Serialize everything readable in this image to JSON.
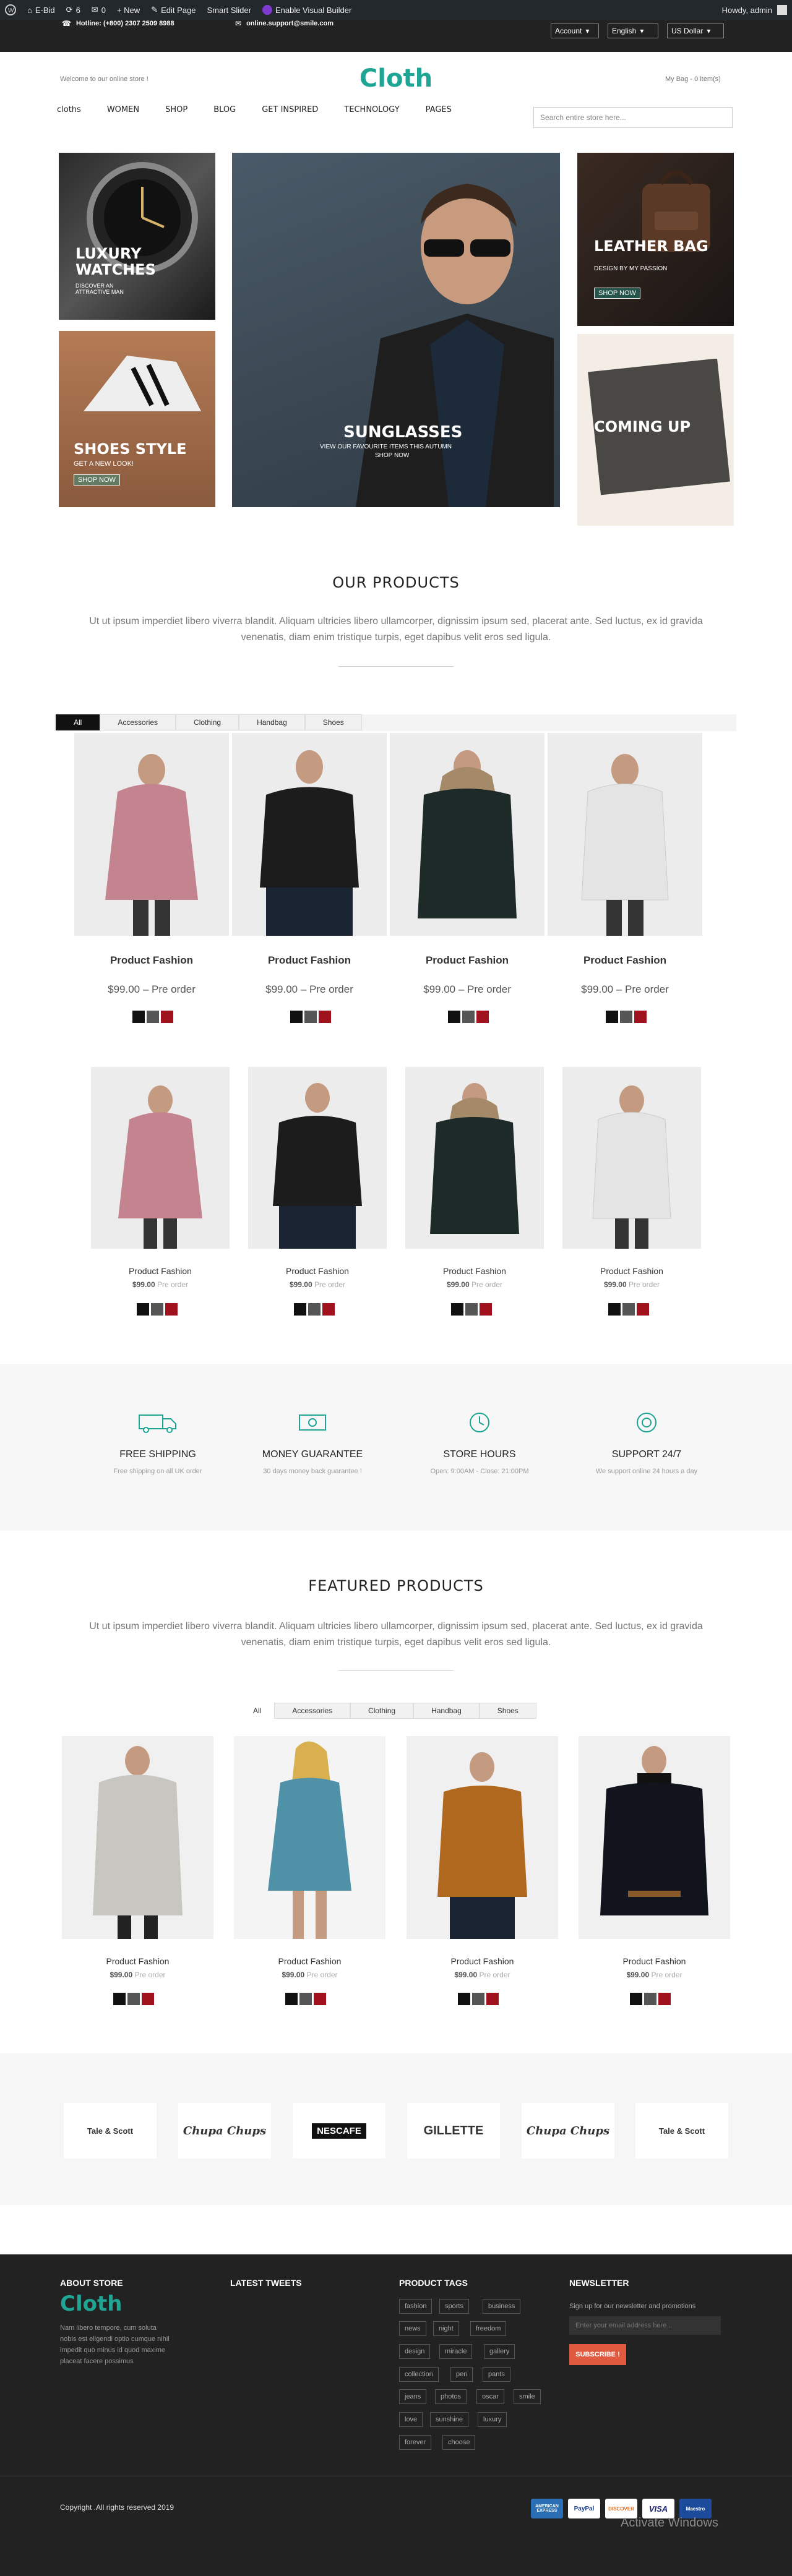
{
  "adminbar": {
    "site_name": "E-Bid",
    "updates_count": "6",
    "comments_count": "0",
    "new_label": "+ New",
    "edit_page": "Edit Page",
    "smart_slider": "Smart Slider",
    "visual_builder": "Enable Visual Builder",
    "howdy": "Howdy, admin"
  },
  "topbar": {
    "hotline": "Hotline: (+800) 2307 2509 8988",
    "email": "online.support@smile.com",
    "account": "Account",
    "language": "English",
    "currency": "US Dollar"
  },
  "header": {
    "welcome": "Welcome to our online store !",
    "logo": "Cloth",
    "cart": "My Bag - 0 item(s)"
  },
  "nav": {
    "items": [
      "cloths",
      "WOMEN",
      "SHOP",
      "BLOG",
      "GET INSPIRED",
      "TECHNOLOGY",
      "PAGES"
    ],
    "search_placeholder": "Search entire store here..."
  },
  "banners": {
    "watches_title": "LUXURY WATCHES",
    "watches_sub": "DISCOVER AN ATTRACTIVE MAN",
    "shoes_title": "SHOES STYLE",
    "shoes_sub": "GET A NEW LOOK!",
    "shoes_btn": "SHOP NOW",
    "sunglasses_title": "SUNGLASSES",
    "sunglasses_sub": "VIEW OUR FAVOURITE ITEMS THIS AUTUMN",
    "sunglasses_btn": "SHOP NOW",
    "bag_title": "LEATHER BAG",
    "bag_sub": "DESIGN BY MY PASSION",
    "bag_btn": "SHOP NOW",
    "coming_title": "COMING UP"
  },
  "our_products": {
    "title": "OUR PRODUCTS",
    "description": "Ut ut ipsum imperdiet libero viverra blandit. Aliquam ultricies libero ullamcorper, dignissim ipsum sed, placerat ante. Sed luctus, ex id gravida venenatis, diam enim tristique turpis, eget dapibus velit eros sed ligula.",
    "tabs": [
      "All",
      "Accessories",
      "Clothing",
      "Handbag",
      "Shoes"
    ],
    "row1": [
      {
        "name": "Product Fashion",
        "price": "$99.00 – Pre order"
      },
      {
        "name": "Product Fashion",
        "price": "$99.00 – Pre order"
      },
      {
        "name": "Product Fashion",
        "price": "$99.00 – Pre order"
      },
      {
        "name": "Product Fashion",
        "price": "$99.00 – Pre order"
      }
    ],
    "row2": [
      {
        "name": "Product Fashion",
        "price": "$99.00",
        "note": "Pre order"
      },
      {
        "name": "Product Fashion",
        "price": "$99.00",
        "note": "Pre order"
      },
      {
        "name": "Product Fashion",
        "price": "$99.00",
        "note": "Pre order"
      },
      {
        "name": "Product Fashion",
        "price": "$99.00",
        "note": "Pre order"
      }
    ]
  },
  "services": [
    {
      "title": "FREE SHIPPING",
      "desc": "Free shipping on all UK order",
      "icon": "truck-icon"
    },
    {
      "title": "MONEY GUARANTEE",
      "desc": "30 days money back guarantee !",
      "icon": "money-icon"
    },
    {
      "title": "STORE HOURS",
      "desc": "Open: 9:00AM - Close: 21:00PM",
      "icon": "clock-icon"
    },
    {
      "title": "SUPPORT 24/7",
      "desc": "We support online 24 hours a day",
      "icon": "support-icon"
    }
  ],
  "featured": {
    "title": "FEATURED PRODUCTS",
    "description": "Ut ut ipsum imperdiet libero viverra blandit. Aliquam ultricies libero ullamcorper, dignissim ipsum sed, placerat ante. Sed luctus, ex id gravida venenatis, diam enim tristique turpis, eget dapibus velit eros sed ligula.",
    "tabs": [
      "All",
      "Accessories",
      "Clothing",
      "Handbag",
      "Shoes"
    ],
    "items": [
      {
        "name": "Product Fashion",
        "price": "$99.00",
        "note": "Pre order"
      },
      {
        "name": "Product Fashion",
        "price": "$99.00",
        "note": "Pre order"
      },
      {
        "name": "Product Fashion",
        "price": "$99.00",
        "note": "Pre order"
      },
      {
        "name": "Product Fashion",
        "price": "$99.00",
        "note": "Pre order"
      }
    ]
  },
  "brands": [
    "Tale & Scott",
    "Chupa Chups",
    "NESCAFE",
    "GILLETTE",
    "Chupa Chups",
    "Tale & Scott"
  ],
  "footer": {
    "about_title": "ABOUT STORE",
    "about_logo": "Cloth",
    "about_text": "Nam libero tempore, cum soluta nobis est eligendi optio cumque nihil impedit quo minus id quod maxime placeat facere possimus",
    "tweets_title": "LATEST TWEETS",
    "tags_title": "PRODUCT TAGS",
    "tags": [
      "fashion",
      "sports",
      "business",
      "news",
      "night",
      "freedom",
      "design",
      "miracle",
      "gallery",
      "collection",
      "pen",
      "pants",
      "jeans",
      "photos",
      "oscar",
      "smile",
      "love",
      "sunshine",
      "luxury",
      "forever",
      "choose"
    ],
    "newsletter_title": "NEWSLETTER",
    "newsletter_text": "Sign up for our newsletter and promotions",
    "newsletter_placeholder": "Enter your email address here...",
    "subscribe": "SUBSCRIBE !",
    "copyright": "Copyright .All rights reserved 2019",
    "payments": [
      "AMERICAN EXPRESS",
      "PayPal",
      "DISCOVER",
      "VISA",
      "Maestro"
    ],
    "watermark": "Activate Windows"
  },
  "colors": {
    "accent": "#1fa594",
    "swatches": [
      "#111111",
      "#555555",
      "#a0121e"
    ]
  }
}
